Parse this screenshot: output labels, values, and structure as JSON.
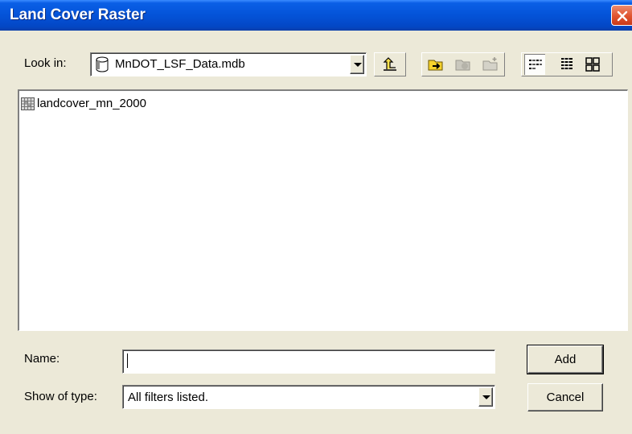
{
  "window": {
    "title": "Land Cover Raster"
  },
  "lookin": {
    "label": "Look in:",
    "value": "MnDOT_LSF_Data.mdb",
    "icon": "database-icon"
  },
  "toolbar": [
    {
      "name": "up-one-level-button",
      "icon": "up-arrow-folder-icon",
      "enabled": true
    },
    {
      "name": "connect-folder-button",
      "icon": "connect-folder-icon",
      "enabled": true
    },
    {
      "name": "disconnect-folder-button",
      "icon": "disconnect-folder-icon",
      "enabled": false
    },
    {
      "name": "new-folder-button",
      "icon": "new-folder-icon",
      "enabled": false
    },
    {
      "name": "list-view-button",
      "icon": "list-view-icon",
      "enabled": true,
      "pressed": true
    },
    {
      "name": "details-view-button",
      "icon": "details-view-icon",
      "enabled": true
    },
    {
      "name": "thumbnails-view-button",
      "icon": "thumbnails-view-icon",
      "enabled": true
    }
  ],
  "files": [
    {
      "name": "landcover_mn_2000",
      "icon": "raster-grid-icon"
    }
  ],
  "name_field": {
    "label": "Name:",
    "value": ""
  },
  "type_field": {
    "label": "Show of type:",
    "value": "All filters listed."
  },
  "buttons": {
    "add": "Add",
    "cancel": "Cancel"
  },
  "colors": {
    "titlebar": "#0453d8",
    "close": "#e0532f",
    "face": "#ece9d8"
  }
}
